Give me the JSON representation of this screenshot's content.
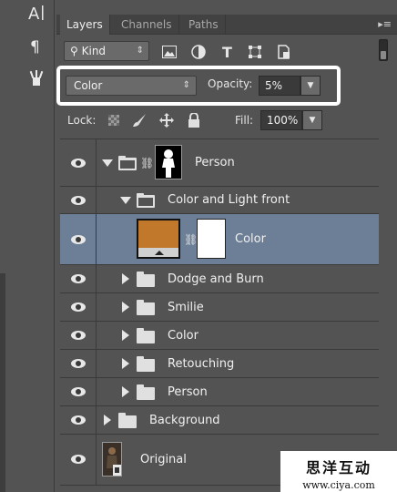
{
  "tabs": [
    {
      "label": "Layers"
    },
    {
      "label": "Channels"
    },
    {
      "label": "Paths"
    }
  ],
  "filter": {
    "kind_label": "Kind"
  },
  "blend": {
    "mode": "Color",
    "opacity_label": "Opacity:",
    "opacity_value": "5%"
  },
  "lock": {
    "label": "Lock:",
    "fill_label": "Fill:",
    "fill_value": "100%"
  },
  "layers": [
    {
      "name": "Person",
      "type": "group-with-mask",
      "expanded": true
    },
    {
      "name": "Color and Light front",
      "type": "group",
      "expanded": true
    },
    {
      "name": "Color",
      "type": "fill-layer-with-mask",
      "selected": true
    },
    {
      "name": "Dodge and Burn",
      "type": "group",
      "expanded": false
    },
    {
      "name": "Smilie",
      "type": "group",
      "expanded": false
    },
    {
      "name": "Color",
      "type": "group",
      "expanded": false
    },
    {
      "name": "Retouching",
      "type": "group",
      "expanded": false
    },
    {
      "name": "Person",
      "type": "group",
      "expanded": false
    },
    {
      "name": "Background",
      "type": "group",
      "expanded": false
    },
    {
      "name": "Original",
      "type": "smart-object"
    }
  ],
  "watermark": {
    "chinese": "思洋互动",
    "url": "www.ciya.com"
  },
  "colors": {
    "selected_row": "#6d7f96",
    "fill_swatch": "#c2782b",
    "highlight_border": "#ffffff"
  }
}
